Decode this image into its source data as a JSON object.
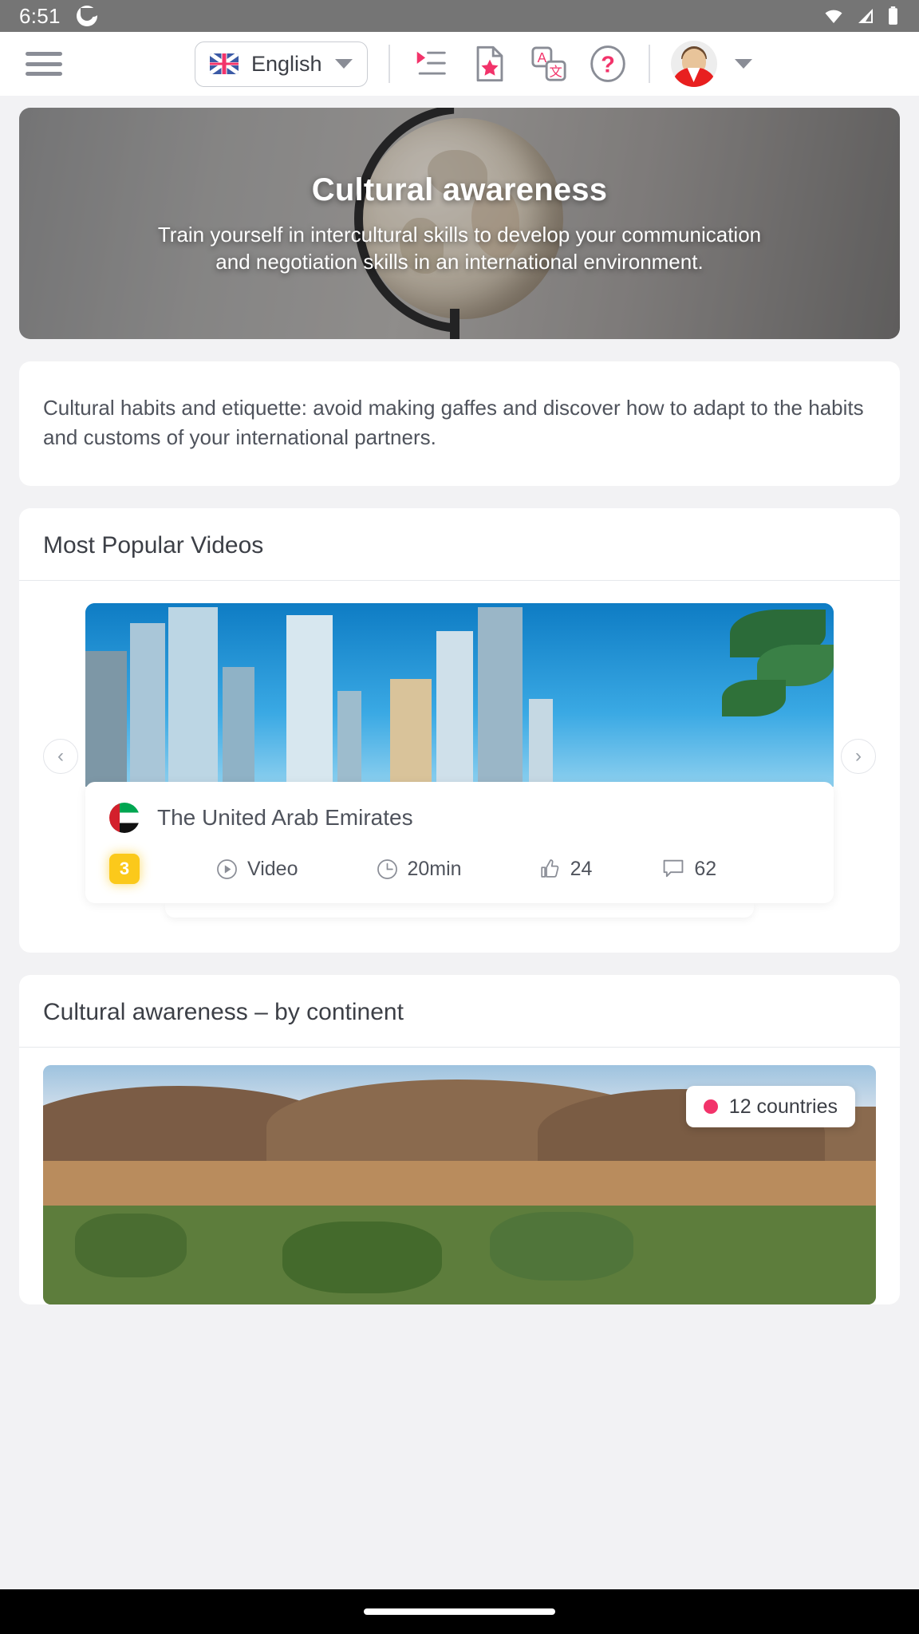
{
  "statusbar": {
    "time": "6:51",
    "app_icon": "app-circle-icon",
    "icons": [
      "wifi-icon",
      "cellular-signal-icon",
      "battery-icon"
    ]
  },
  "header": {
    "menu_icon": "hamburger-menu-icon",
    "language": {
      "flag": "uk-flag-icon",
      "label": "English",
      "caret": "chevron-down-icon"
    },
    "actions": [
      {
        "name": "playlist-icon",
        "label": "Playlist"
      },
      {
        "name": "favorite-document-icon",
        "label": "Favorites"
      },
      {
        "name": "translate-icon",
        "label": "Translate"
      },
      {
        "name": "help-icon",
        "label": "Help"
      }
    ],
    "translate_glyphs": {
      "source": "A",
      "target": "文"
    },
    "help_glyph": "?",
    "avatar": "user-avatar",
    "avatar_caret": "chevron-down-icon"
  },
  "hero": {
    "title": "Cultural awareness",
    "subtitle": "Train yourself in intercultural skills to develop your communication and negotiation skills in an international environment."
  },
  "description": {
    "text": "Cultural habits and etiquette: avoid making gaffes and discover how to adapt to the habits and customs of your international partners."
  },
  "popular": {
    "section_title": "Most Popular Videos",
    "prev_label": "‹",
    "next_label": "›",
    "video": {
      "flag": "uae-flag-icon",
      "title": "The United Arab Emirates",
      "badge": "3",
      "type_icon": "play-circle-icon",
      "type_label": "Video",
      "duration_icon": "clock-icon",
      "duration_label": "20min",
      "likes_icon": "thumbs-up-icon",
      "likes": "24",
      "comments_icon": "comment-icon",
      "comments": "62"
    }
  },
  "continents": {
    "section_title": "Cultural awareness – by continent",
    "badge_label": "12 countries",
    "badge_dot_color": "#f2336a"
  },
  "colors": {
    "accent": "#f2336a",
    "badge_yellow": "#fbc91b",
    "text": "#4f535c",
    "statusbar": "#757575"
  }
}
